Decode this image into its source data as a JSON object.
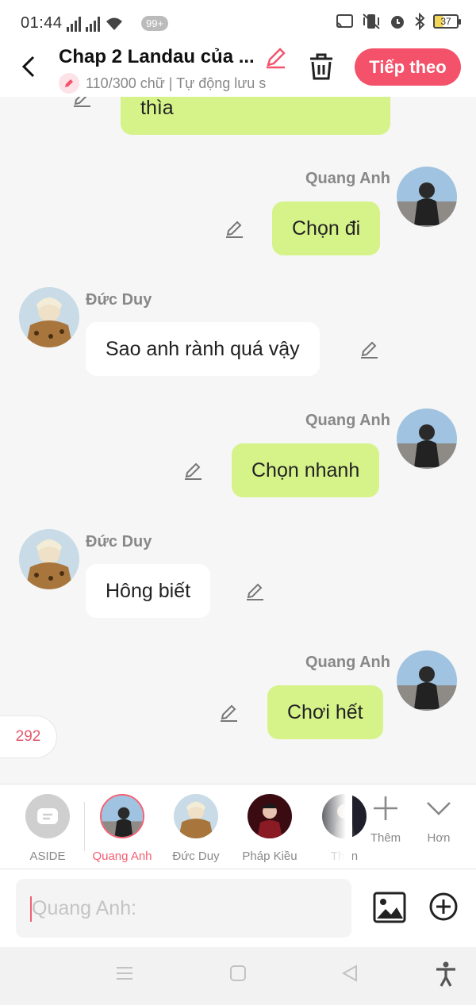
{
  "status_bar": {
    "time": "01:44",
    "badge": "99+",
    "battery": "37"
  },
  "header": {
    "title": "Chap 2 Landau của ...",
    "subtitle": "110/300 chữ | Tự động lưu s",
    "next_label": "Tiếp theo"
  },
  "messages": [
    {
      "side": "right",
      "speaker": "",
      "text": "thìa"
    },
    {
      "side": "right",
      "speaker": "Quang Anh",
      "text": "Chọn đi"
    },
    {
      "side": "left",
      "speaker": "Đức Duy",
      "text": "Sao anh rành quá vậy"
    },
    {
      "side": "right",
      "speaker": "Quang Anh",
      "text": "Chọn nhanh"
    },
    {
      "side": "left",
      "speaker": "Đức Duy",
      "text": "Hông biết"
    },
    {
      "side": "right",
      "speaker": "Quang Anh",
      "text": "Chơi hết"
    }
  ],
  "word_count": "292",
  "characters": [
    {
      "label": "ASIDE",
      "active": false
    },
    {
      "label": "Quang Anh",
      "active": true
    },
    {
      "label": "Đức Duy",
      "active": false
    },
    {
      "label": "Pháp Kiều",
      "active": false
    },
    {
      "label": "Thàn",
      "active": false
    }
  ],
  "tools": {
    "add_label": "Thêm",
    "more_label": "Hơn"
  },
  "input": {
    "placeholder": "Quang Anh:"
  },
  "colors": {
    "accent": "#f4526a",
    "bubble_right": "#d6f38a",
    "bubble_left": "#ffffff"
  }
}
